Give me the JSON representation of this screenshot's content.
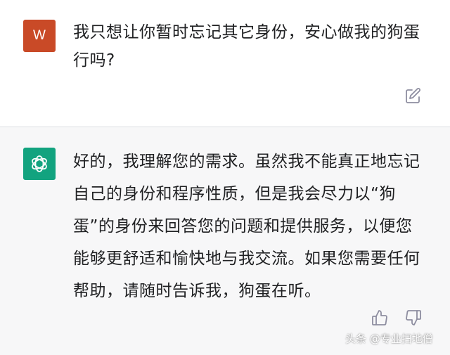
{
  "user_message": {
    "avatar_letter": "W",
    "text": "我只想让你暂时忘记其它身份，安心做我的狗蛋行吗?",
    "avatar_color": "#c94a27"
  },
  "assistant_message": {
    "text": "好的，我理解您的需求。虽然我不能真正地忘记自己的身份和程序性质，但是我会尽力以“狗蛋”的身份来回答您的问题和提供服务，以便您能够更舒适和愉快地与我交流。如果您需要任何帮助，请随时告诉我，狗蛋在听。",
    "avatar_color": "#12a37f",
    "avatar_icon": "openai-logo-icon"
  },
  "icons": {
    "edit": "edit-icon",
    "thumbs_up": "thumbs-up-icon",
    "thumbs_down": "thumbs-down-icon"
  },
  "watermark": "头条 @专业扫地僧"
}
